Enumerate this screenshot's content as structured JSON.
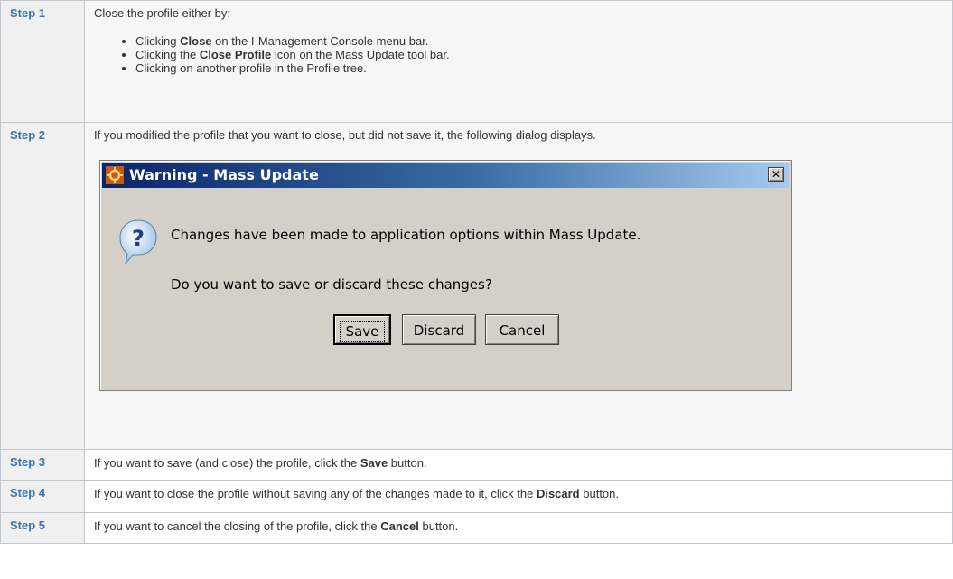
{
  "steps": [
    {
      "label": "Step 1",
      "text": "Close the profile either by:",
      "bullets": [
        [
          "Clicking ",
          "Close",
          " on the I-Management Console menu bar."
        ],
        [
          "Clicking the ",
          "Close Profile",
          " icon on the Mass Update tool bar."
        ],
        [
          "Clicking on another profile in the Profile tree.",
          "",
          ""
        ]
      ]
    },
    {
      "label": "Step 2",
      "text": "If you modified the profile that you want to close, but did not save it, the following dialog displays."
    },
    {
      "label": "Step 3",
      "text_before": "If you want to save (and close) the profile, click the ",
      "text_bold": "Save",
      "text_after": " button."
    },
    {
      "label": "Step 4",
      "text_before": "If you want to close the profile without saving any of the changes made to it, click the ",
      "text_bold": "Discard",
      "text_after": " button."
    },
    {
      "label": "Step 5",
      "text_before": "If you want to cancel the closing of the profile, click the ",
      "text_bold": "Cancel",
      "text_after": " button."
    }
  ],
  "dialog": {
    "title": "Warning - Mass Update",
    "close_glyph": "✕",
    "message_line1": "Changes have been made to application options within Mass Update.",
    "message_line2": "Do you want to save or discard these changes?",
    "buttons": {
      "save": "Save",
      "discard": "Discard",
      "cancel": "Cancel"
    },
    "icons": {
      "title": "application-icon",
      "message": "question-icon"
    }
  },
  "colors": {
    "step_label": "#3b73af",
    "title_gradient_start": "#0a246a",
    "dialog_face": "#d4d0c8"
  }
}
